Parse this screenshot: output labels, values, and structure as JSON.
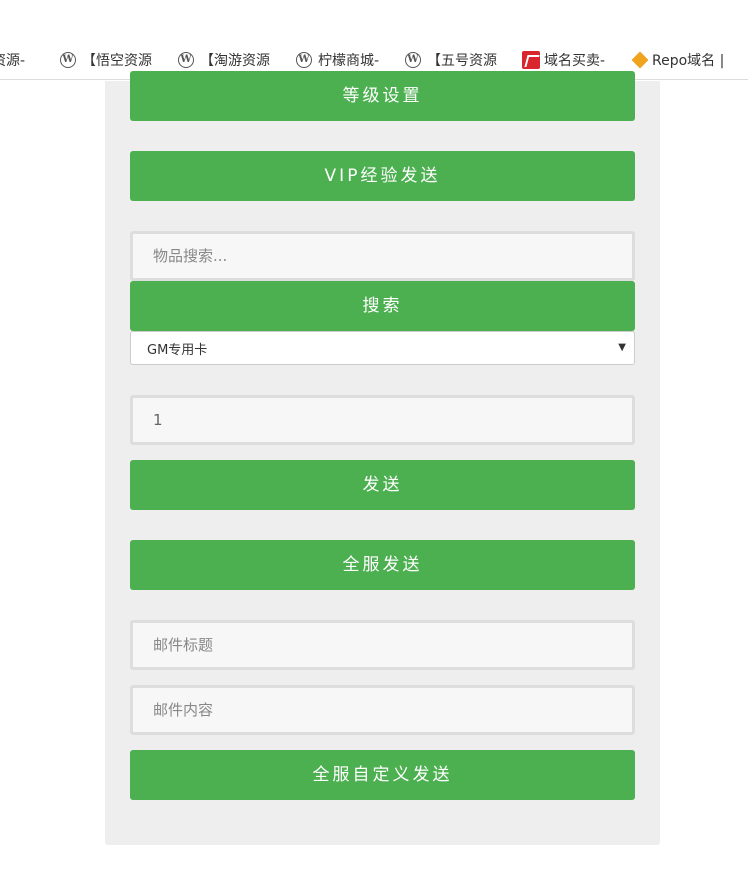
{
  "bookmarks": [
    {
      "label": "资源-",
      "icon": "none"
    },
    {
      "label": "【悟空资源",
      "icon": "wordpress-icon"
    },
    {
      "label": "【淘游资源",
      "icon": "wordpress-icon"
    },
    {
      "label": "柠檬商城-",
      "icon": "wordpress-icon"
    },
    {
      "label": "【五号资源",
      "icon": "wordpress-icon"
    },
    {
      "label": "域名买卖-",
      "icon": "red-site-icon"
    },
    {
      "label": "Repo域名 |",
      "icon": "diamond-icon"
    }
  ],
  "wp_glyph": "W",
  "form": {
    "level_setting_label": "等级设置",
    "vip_exp_send_label": "VIP经验发送",
    "item_search_placeholder": "物品搜索...",
    "search_label": "搜索",
    "item_select_value": "GM专用卡",
    "select_arrow": "▼",
    "quantity_value": "1",
    "send_label": "发送",
    "server_send_label": "全服发送",
    "mail_title_placeholder": "邮件标题",
    "mail_content_placeholder": "邮件内容",
    "server_custom_send_label": "全服自定义发送"
  },
  "colors": {
    "accent": "#4caf50",
    "panel_bg": "#eeeeee",
    "input_bg": "#f7f7f7"
  }
}
